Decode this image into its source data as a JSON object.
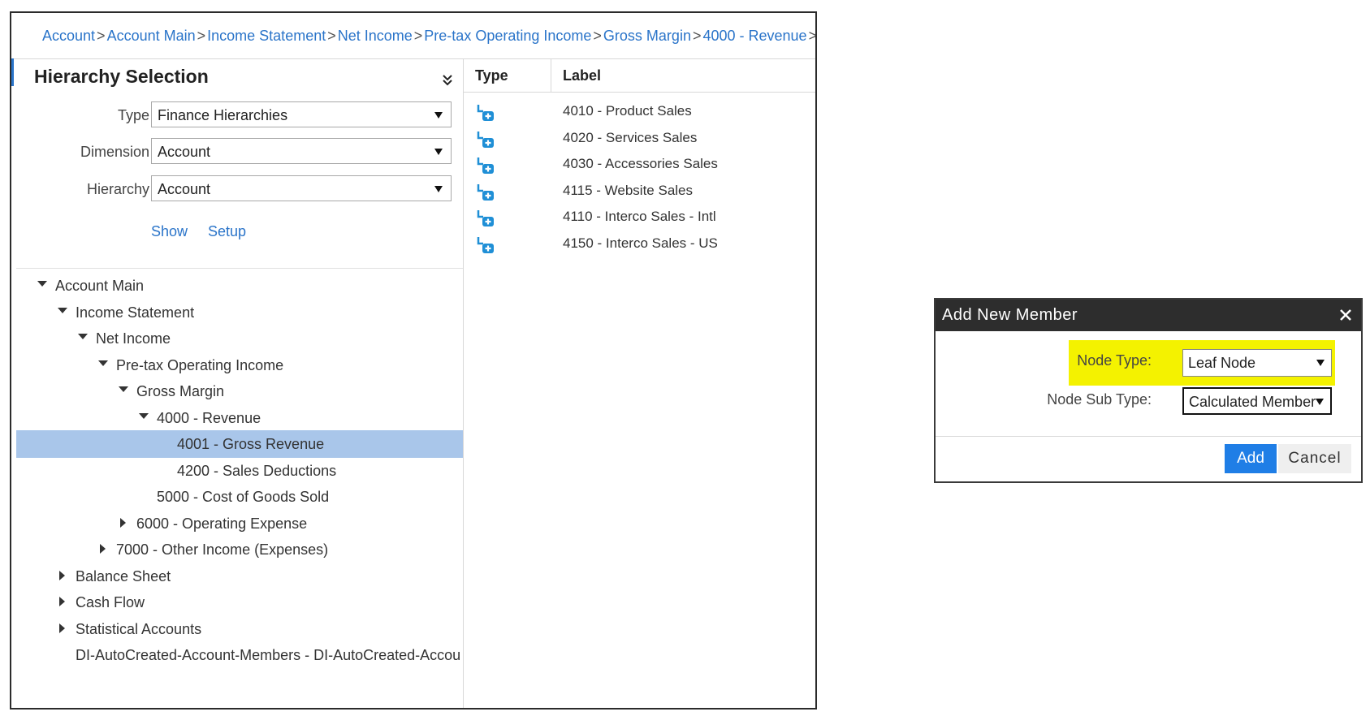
{
  "breadcrumb": {
    "items": [
      "Account",
      "Account Main",
      "Income Statement",
      "Net Income",
      "Pre-tax Operating Income",
      "Gross Margin",
      "4000 - Revenue"
    ],
    "separator": ">"
  },
  "hierarchy": {
    "title": "Hierarchy Selection",
    "type_label": "Type",
    "type_value": "Finance Hierarchies",
    "dimension_label": "Dimension",
    "dimension_value": "Account",
    "hierarchy_label": "Hierarchy",
    "hierarchy_value": "Account",
    "show_link": "Show",
    "setup_link": "Setup"
  },
  "tree": {
    "items": [
      {
        "label": "Account Main",
        "toggle": "open",
        "selected": false
      },
      {
        "label": "Income Statement",
        "toggle": "open",
        "selected": false
      },
      {
        "label": "Net Income",
        "toggle": "open",
        "selected": false
      },
      {
        "label": "Pre-tax Operating Income",
        "toggle": "open",
        "selected": false
      },
      {
        "label": "Gross Margin",
        "toggle": "open",
        "selected": false
      },
      {
        "label": "4000 - Revenue",
        "toggle": "open",
        "selected": false
      },
      {
        "label": "4001 - Gross Revenue",
        "toggle": "none",
        "selected": true
      },
      {
        "label": "4200 - Sales Deductions",
        "toggle": "none",
        "selected": false
      },
      {
        "label": "5000 - Cost of Goods Sold",
        "toggle": "none",
        "selected": false
      },
      {
        "label": "6000 - Operating Expense",
        "toggle": "closed",
        "selected": false
      },
      {
        "label": "7000 - Other Income (Expenses)",
        "toggle": "closed",
        "selected": false
      },
      {
        "label": "Balance Sheet",
        "toggle": "closed",
        "selected": false
      },
      {
        "label": "Cash Flow",
        "toggle": "closed",
        "selected": false
      },
      {
        "label": "Statistical Accounts",
        "toggle": "closed",
        "selected": false
      },
      {
        "label": "DI-AutoCreated-Account-Members - DI-AutoCreated-Accou",
        "toggle": "none",
        "selected": false
      }
    ]
  },
  "grid": {
    "col_type": "Type",
    "col_label": "Label",
    "rows": [
      {
        "icon": "add-member-icon",
        "label": "4010 - Product Sales"
      },
      {
        "icon": "add-member-icon",
        "label": "4020 - Services Sales"
      },
      {
        "icon": "add-member-icon",
        "label": "4030 - Accessories Sales"
      },
      {
        "icon": "add-member-icon",
        "label": "4115 - Website Sales"
      },
      {
        "icon": "add-member-icon",
        "label": "4110 - Interco Sales - Intl"
      },
      {
        "icon": "add-member-icon",
        "label": "4150 - Interco Sales - US"
      }
    ]
  },
  "dialog": {
    "title": "Add New Member",
    "node_type_label": "Node Type:",
    "node_type_value": "Leaf Node",
    "node_sub_type_label": "Node Sub Type:",
    "node_sub_type_value": "Calculated Member",
    "add_label": "Add",
    "cancel_label": "Cancel"
  },
  "colors": {
    "link": "#2a74c9",
    "selected_row": "#a9c6ea",
    "highlight": "#f4f200",
    "primary_button": "#1f7ee6",
    "dialog_titlebar": "#2d2d2d"
  }
}
